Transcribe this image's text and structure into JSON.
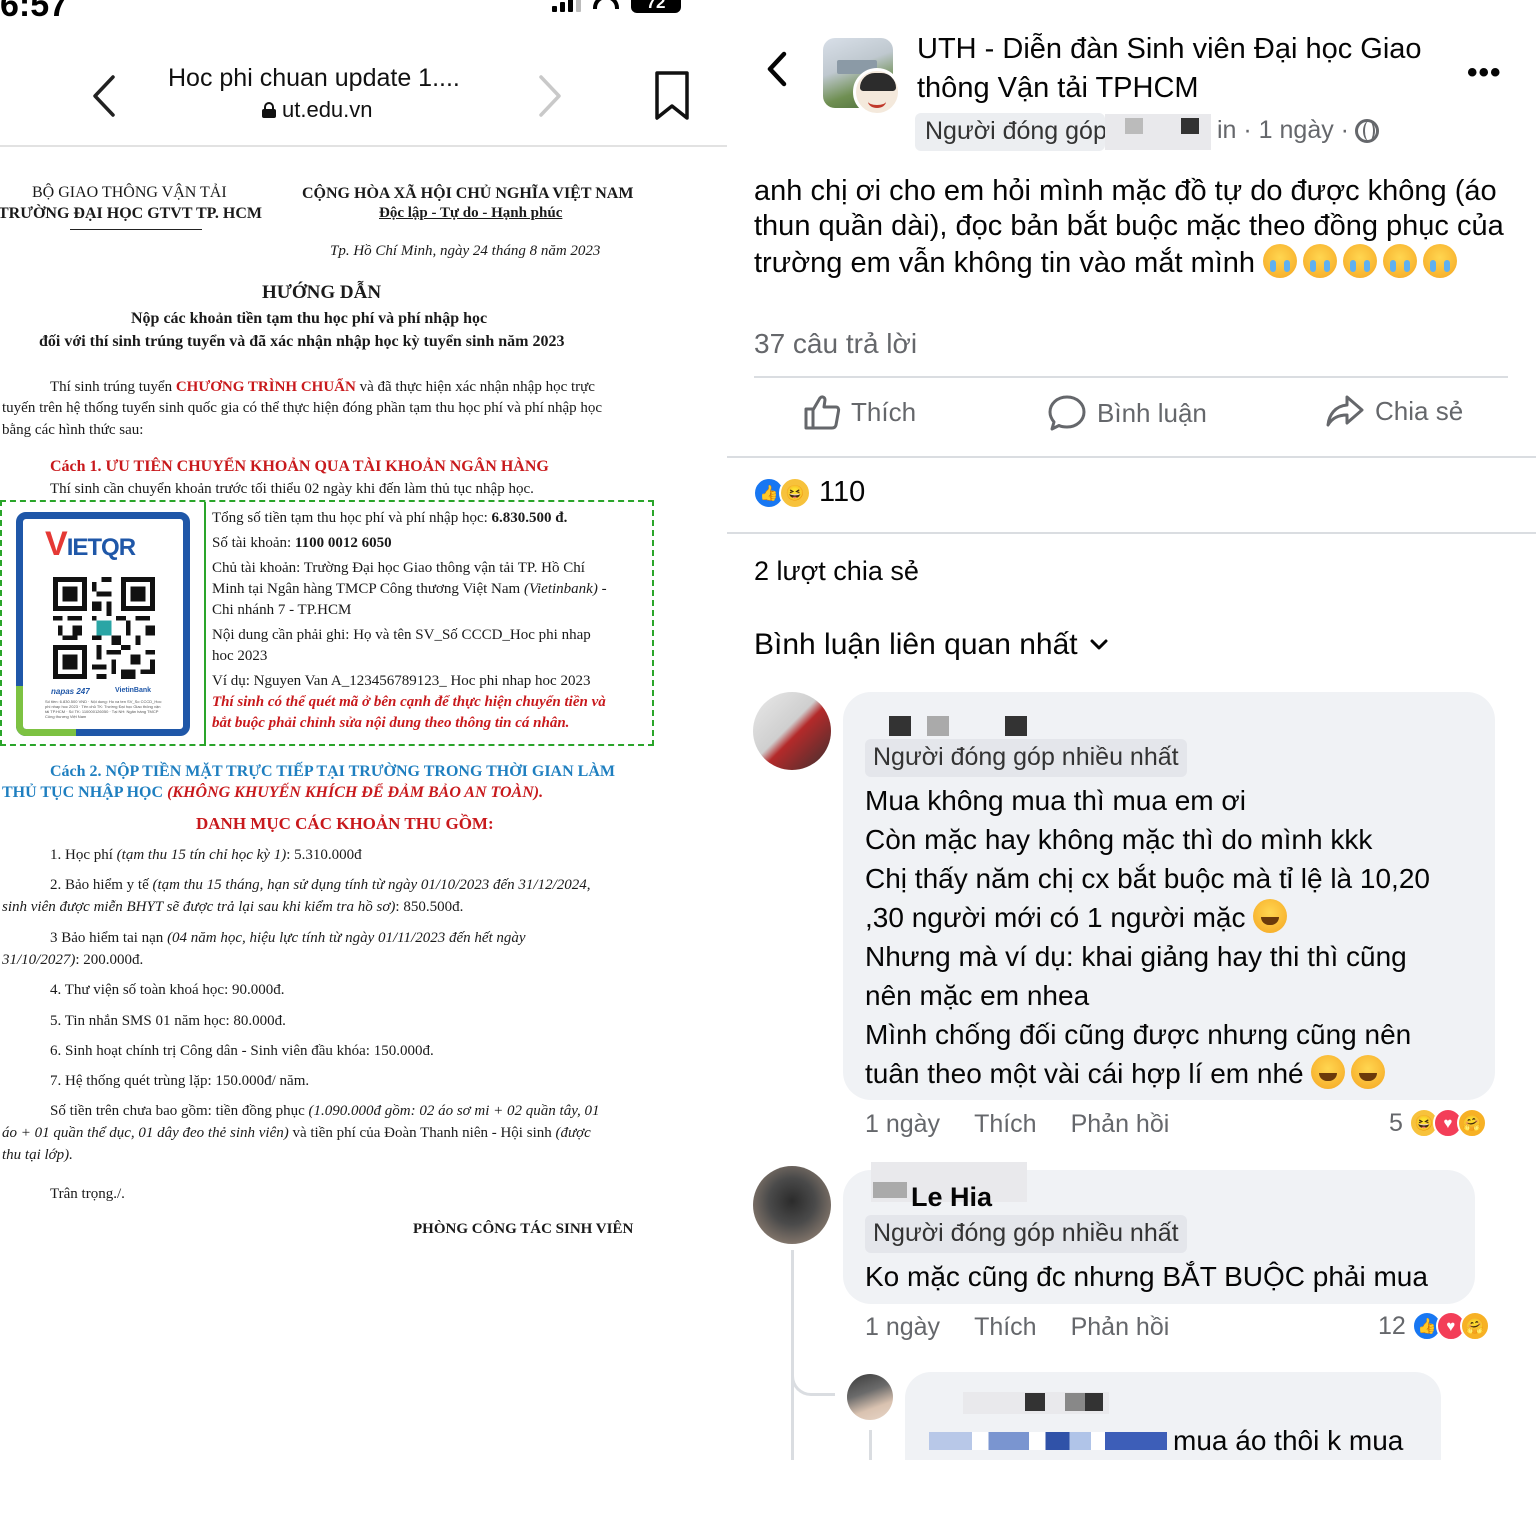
{
  "status_bar": {
    "time": "6:57",
    "battery": "72"
  },
  "browser": {
    "title": "Hoc phi chuan update 1....",
    "url": "ut.edu.vn"
  },
  "document": {
    "ministry": "BỘ GIAO THÔNG VẬN TẢI",
    "university": "TRƯỜNG ĐẠI HỌC GTVT TP. HCM",
    "republic": "CỘNG HÒA XÃ HỘI CHỦ NGHĨA VIỆT NAM",
    "motto": "Độc lập - Tự do - Hạnh phúc",
    "date": "Tp. Hồ Chí Minh, ngày 24 tháng 8 năm 2023",
    "heading": "HƯỚNG DẪN",
    "subheading_1": "Nộp các khoản tiền tạm thu học phí và phí nhập học",
    "subheading_2": "đối với thí sinh trúng tuyển và đã xác nhận nhập học kỳ tuyển sinh năm 2023",
    "intro_1a": "Thí sinh trúng tuyển ",
    "intro_1b": "CHƯƠNG TRÌNH CHUẨN",
    "intro_1c": " và đã thực hiện xác nhận nhập học trực",
    "intro_2": "tuyến trên hệ thống tuyển sinh quốc gia có thể thực hiện đóng phần tạm thu học phí và phí nhập học",
    "intro_3": "bằng các hình thức sau:",
    "method_1": "Cách 1. ƯU TIÊN CHUYỂN KHOẢN QUA TÀI KHOẢN NGÂN HÀNG",
    "method_1_note": "Thí sinh cần chuyển khoản trước tối thiểu 02 ngày khi đến làm thủ tục nhập học.",
    "qr_logo_v": "V",
    "qr_logo_rest": "IETQR",
    "qr_napas": "napas 247",
    "qr_bank": "VietinBank",
    "qr_small": "Số tiền: 6.830.500 VND · Nội dung: Ho va ten SV_So CCCD_Hoc phi nhap hoc 2023 · Tên chủ TK: Trường Đại học Giao thông vận tải TP.HCM · Số TK: 110000126050 · Tại NH: Ngân hàng TMCP Công thương Việt Nam",
    "total_label": "Tổng số tiền tạm thu học phí và phí nhập học: ",
    "total_value": "6.830.500 đ.",
    "account_label": "Số tài khoản: ",
    "account_value": "1100 0012 6050",
    "holder_1": "Chủ tài khoản: Trường Đại học Giao thông vận tải TP. Hồ Chí",
    "holder_2a": "Minh tại Ngân hàng TMCP Công thương Việt Nam ",
    "holder_2b": "(Vietinbank)",
    "holder_2c": " -",
    "holder_3": "Chi nhánh 7 - TP.HCM",
    "content_1": "Nội dung cần phải ghi: Họ và tên SV_Số CCCD_Hoc phi nhap",
    "content_2": "hoc 2023",
    "example": "Ví dụ: Nguyen Van A_123456789123_ Hoc phi nhap hoc 2023",
    "warning_1": "Thí sinh có thể quét mã ở bên cạnh để thực hiện chuyển tiền và",
    "warning_2": "bắt buộc phải chỉnh sửa nội dung theo thông tin cá nhân.",
    "method_2_1": "Cách 2. NỘP TIỀN MẶT TRỰC TIẾP TẠI TRƯỜNG TRONG THỜI GIAN LÀM",
    "method_2_2a": "THỦ TỤC NHẬP HỌC ",
    "method_2_2b": "(KHÔNG KHUYẾN KHÍCH ĐỂ ĐẢM BẢO AN TOÀN).",
    "list_title": "DANH MỤC CÁC KHOẢN THU GỒM:",
    "item_1a": "1. Học phí ",
    "item_1b": "(tạm thu 15 tín chỉ học kỳ 1)",
    "item_1c": ": 5.310.000đ",
    "item_2a": "2. Bảo hiểm y tế ",
    "item_2b": "(tạm thu 15 tháng, hạn sử dụng tính từ ngày 01/10/2023 đến 31/12/2024,",
    "item_2c": "sinh viên được miễn BHYT sẽ được trả lại sau khi kiểm tra hồ sơ)",
    "item_2d": ": 850.500đ.",
    "item_3a": "3 Bảo hiểm tai nạn ",
    "item_3b": "(04 năm học, hiệu lực tính từ ngày   01/11/2023 đến hết ngày",
    "item_3c": "31/10/2027)",
    "item_3d": ": 200.000đ.",
    "item_4": "4. Thư viện số toàn khoá học: 90.000đ.",
    "item_5": "5. Tin nhắn SMS 01 năm học: 80.000đ.",
    "item_6": "6. Sinh hoạt chính trị Công dân - Sinh viên đầu khóa: 150.000đ.",
    "item_7": "7. Hệ thống quét trùng lặp: 150.000đ/ năm.",
    "note_1a": "Số tiền trên chưa bao gồm: tiền đồng phục ",
    "note_1b": "(1.090.000đ gồm: 02 áo sơ mi + 02 quần tây, 01",
    "note_2a": "áo + 01 quần thể dục, 01 dây đeo thẻ sinh viên)",
    "note_2b": " và tiền phí của Đoàn Thanh niên - Hội sinh ",
    "note_2c": "(được",
    "note_3": "thu tại lớp).",
    "closing": "Trân trọng./.",
    "signature": "PHÒNG CÔNG TÁC SINH VIÊN"
  },
  "facebook": {
    "group_name": "UTH - Diễn đàn Sinh viên Đại học Giao thông Vận tải TPHCM",
    "author_badge": "Người đóng góp",
    "meta_tail": "in · 1 ngày ·",
    "post_text": "anh chị ơi cho em hỏi mình mặc đồ tự do được không (áo thun quần dài), đọc bản bắt buộc mặc theo đồng phục của trường em vẫn không tin vào mắt mình",
    "reply_count": "37 câu trả lời",
    "actions": {
      "like": "Thích",
      "comment": "Bình luận",
      "share": "Chia sẻ"
    },
    "reaction_total": "110",
    "shares": "2 lượt chia sẻ",
    "sort_label": "Bình luận liên quan nhất",
    "comments": [
      {
        "badge": "Người đóng góp nhiều nhất",
        "text": "Mua không mua thì mua em ơi\nCòn mặc hay không mặc thì do mình kkk\n Chị thấy năm chị cx bắt buộc mà tỉ lệ là 10,20\n,30 người mới có 1 người mặc",
        "text_2": "Nhưng mà ví dụ: khai giảng hay thi thì cũng\nnên mặc em nhea\nMình chống đối cũng được nhưng cũng nên\ntuân theo một vài cái hợp lí em nhé",
        "time": "1 ngày",
        "like": "Thích",
        "reply": "Phản hồi",
        "reactions": "5"
      },
      {
        "name_partial": "Le Hia",
        "badge": "Người đóng góp nhiều nhất",
        "text": "Ko mặc cũng đc nhưng BẮT BUỘC phải mua",
        "time": "1 ngày",
        "like": "Thích",
        "reply": "Phản hồi",
        "reactions": "12"
      },
      {
        "text": "mua áo thôi k mua"
      }
    ]
  }
}
